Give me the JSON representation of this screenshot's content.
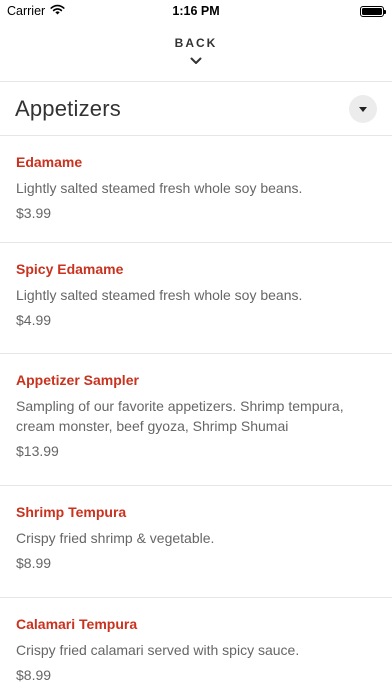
{
  "status_bar": {
    "carrier": "Carrier",
    "time": "1:16 PM"
  },
  "header": {
    "back_label": "BACK",
    "chevron_icon": "chevron-down-icon"
  },
  "section": {
    "title": "Appetizers",
    "toggle_icon": "caret-down-icon"
  },
  "menu": {
    "items": [
      {
        "name": "Edamame",
        "description": "Lightly salted steamed fresh whole soy beans.",
        "price": "$3.99"
      },
      {
        "name": "Spicy Edamame",
        "description": "Lightly salted steamed fresh whole soy beans.",
        "price": "$4.99"
      },
      {
        "name": "Appetizer Sampler",
        "description": "Sampling of our favorite appetizers. Shrimp tempura, cream monster, beef gyoza, Shrimp Shumai",
        "price": "$13.99"
      },
      {
        "name": "Shrimp Tempura",
        "description": "Crispy fried shrimp & vegetable.",
        "price": "$8.99"
      },
      {
        "name": "Calamari Tempura",
        "description": "Crispy fried calamari served with spicy sauce.",
        "price": "$8.99"
      }
    ]
  },
  "colors": {
    "item_name": "#c8321e",
    "text_secondary": "#666666",
    "divider": "#e6e6e6"
  }
}
